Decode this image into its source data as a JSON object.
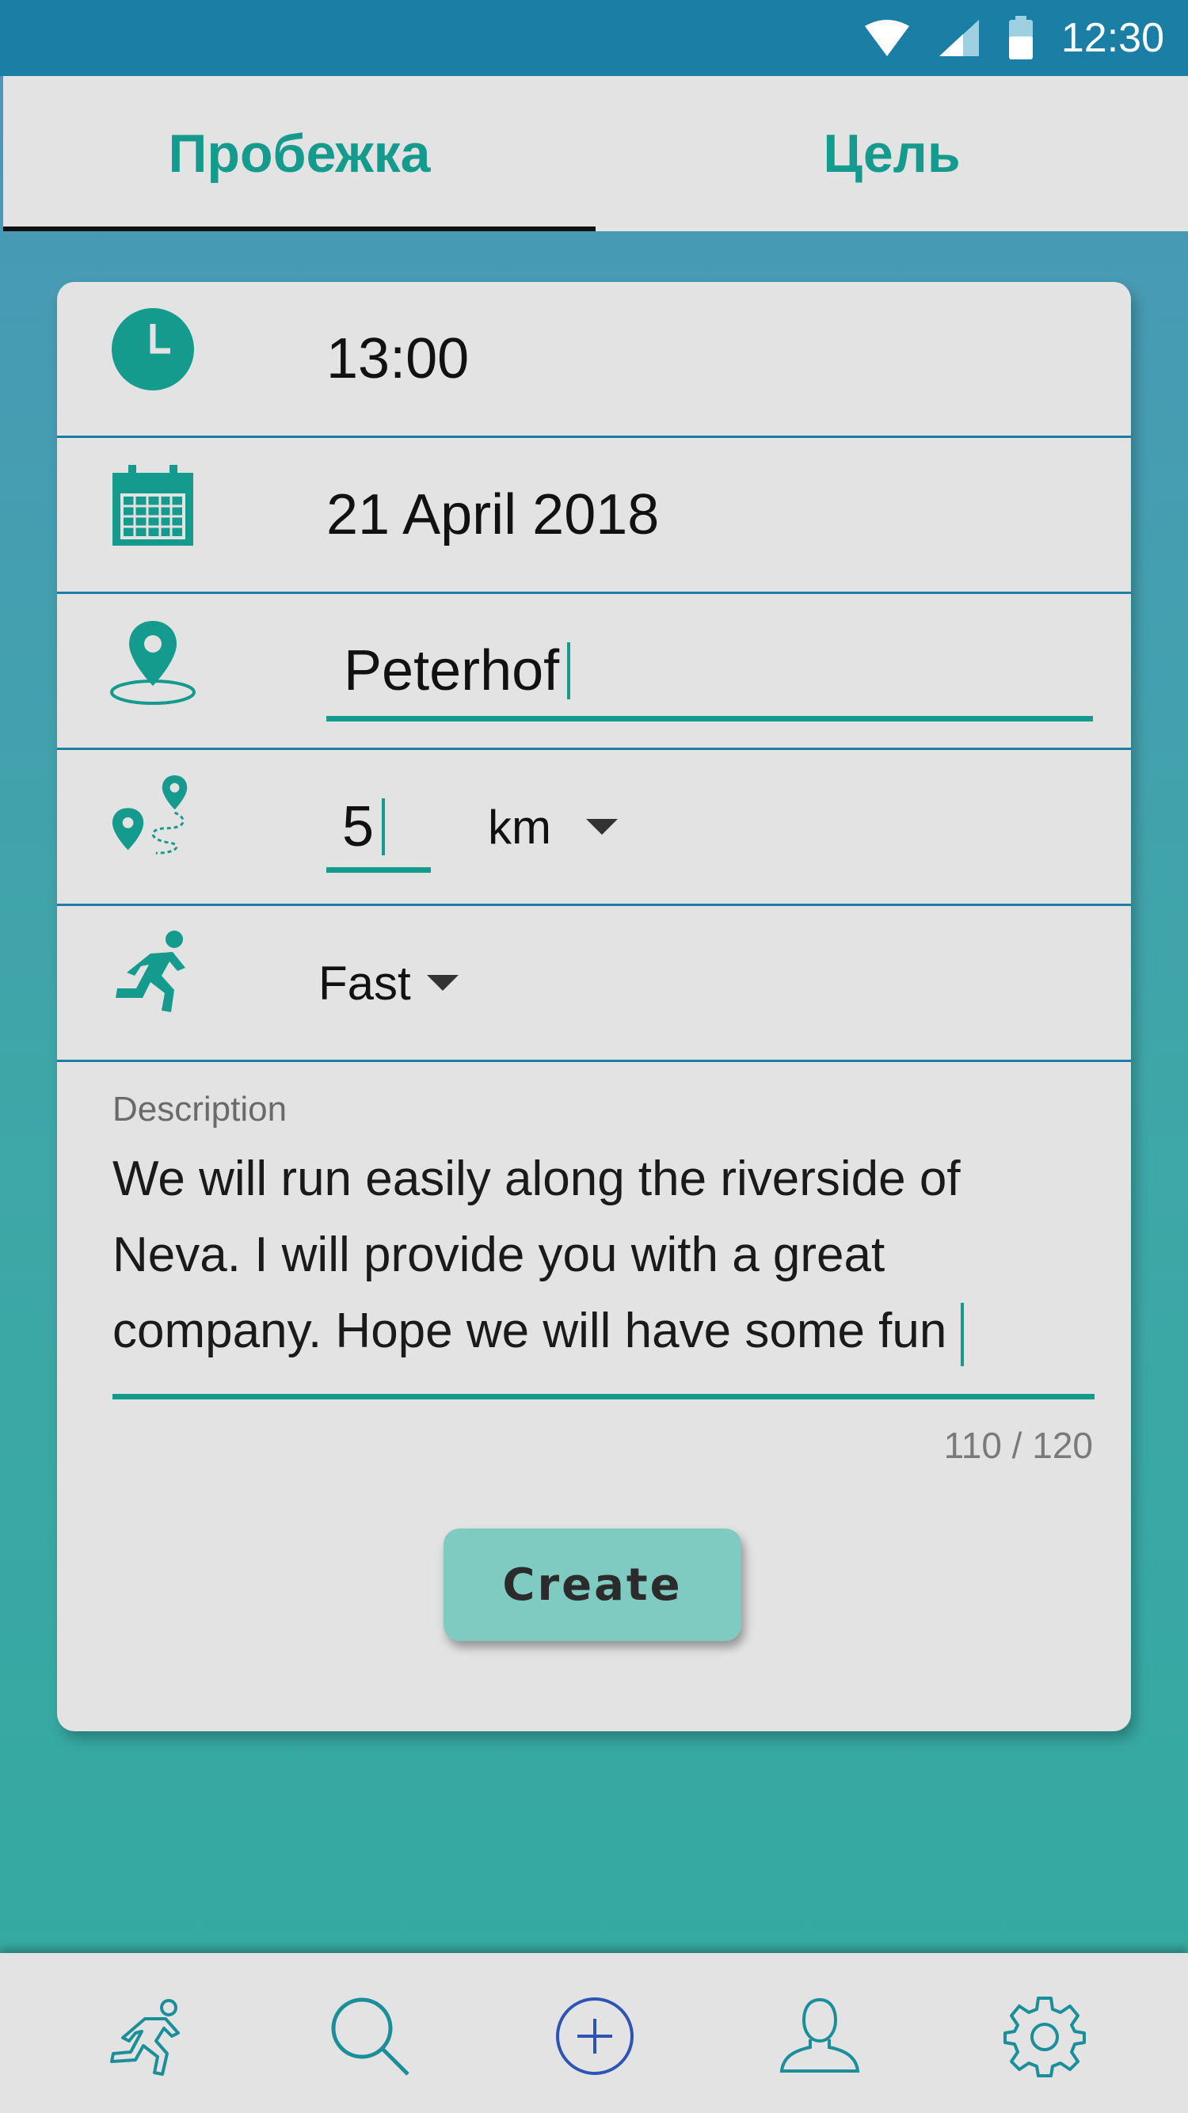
{
  "status_bar": {
    "time": "12:30"
  },
  "tabs": [
    {
      "label": "Пробежка",
      "active": true
    },
    {
      "label": "Цель",
      "active": false
    }
  ],
  "form": {
    "time": "13:00",
    "date": "21 April 2018",
    "location": "Peterhof",
    "distance": "5",
    "distance_unit": "km",
    "pace": "Fast",
    "description_label": "Description",
    "description_value": "We will run easily along the riverside of Neva. I will provide you with a great company. Hope we will have some fun",
    "char_counter": "110 / 120",
    "create_label": "Create"
  },
  "bottom_nav": [
    "run-icon",
    "search-icon",
    "add-icon",
    "profile-icon",
    "settings-icon"
  ],
  "colors": {
    "accent": "#159b8e",
    "status_bar": "#1a7ea5",
    "button": "#7fcbc2",
    "nav_icon": "#1a8f9a",
    "add_icon": "#2d54b5"
  }
}
